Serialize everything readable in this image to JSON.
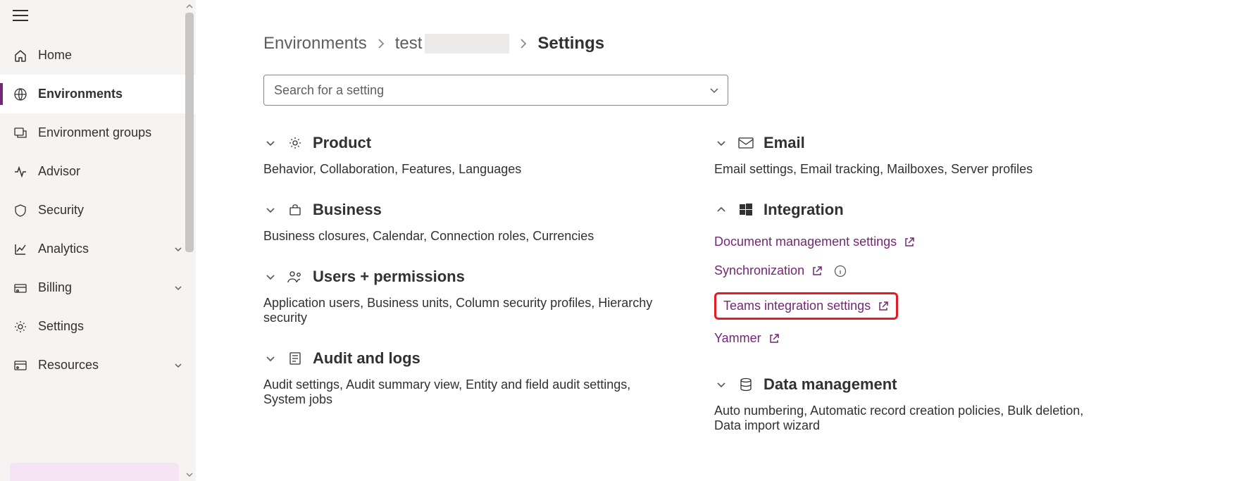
{
  "sidebar": {
    "items": [
      {
        "label": "Home"
      },
      {
        "label": "Environments"
      },
      {
        "label": "Environment groups"
      },
      {
        "label": "Advisor"
      },
      {
        "label": "Security"
      },
      {
        "label": "Analytics"
      },
      {
        "label": "Billing"
      },
      {
        "label": "Settings"
      },
      {
        "label": "Resources"
      }
    ]
  },
  "breadcrumb": {
    "root": "Environments",
    "env": "test",
    "current": "Settings"
  },
  "search": {
    "placeholder": "Search for a setting"
  },
  "left_sections": [
    {
      "title": "Product",
      "desc": "Behavior, Collaboration, Features, Languages"
    },
    {
      "title": "Business",
      "desc": "Business closures, Calendar, Connection roles, Currencies"
    },
    {
      "title": "Users + permissions",
      "desc": "Application users, Business units, Column security profiles, Hierarchy security"
    },
    {
      "title": "Audit and logs",
      "desc": "Audit settings, Audit summary view, Entity and field audit settings, System jobs"
    }
  ],
  "right_sections": {
    "email": {
      "title": "Email",
      "desc": "Email settings, Email tracking, Mailboxes, Server profiles"
    },
    "integration": {
      "title": "Integration",
      "links": [
        {
          "label": "Document management settings"
        },
        {
          "label": "Synchronization",
          "info": true
        },
        {
          "label": "Teams integration settings",
          "highlight": true
        },
        {
          "label": "Yammer"
        }
      ]
    },
    "datamgmt": {
      "title": "Data management",
      "desc": "Auto numbering, Automatic record creation policies, Bulk deletion, Data import wizard"
    }
  }
}
